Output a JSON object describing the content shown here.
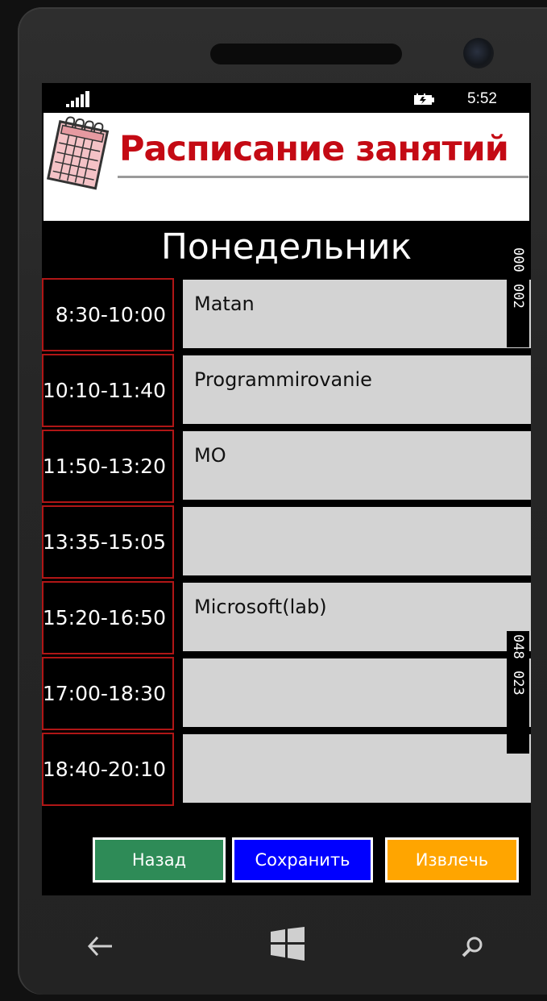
{
  "status_bar": {
    "time": "5:52",
    "signal_icon": "signal-strength-icon",
    "battery_icon": "battery-charging-icon"
  },
  "banner": {
    "title": "Расписание занятий",
    "icon": "calendar-icon"
  },
  "day_title": "Понедельник",
  "schedule": [
    {
      "time": "8:30-10:00",
      "subject": "Matan"
    },
    {
      "time": "10:10-11:40",
      "subject": "Programmirovanie"
    },
    {
      "time": "11:50-13:20",
      "subject": "MO"
    },
    {
      "time": "13:35-15:05",
      "subject": ""
    },
    {
      "time": "15:20-16:50",
      "subject": "Microsoft(lab)"
    },
    {
      "time": "17:00-18:30",
      "subject": ""
    },
    {
      "time": "18:40-20:10",
      "subject": ""
    }
  ],
  "debug_counters": {
    "top": [
      "000",
      "002"
    ],
    "bottom": [
      "048",
      "023"
    ]
  },
  "buttons": {
    "back": {
      "label": "Назад",
      "color": "#2e8b57"
    },
    "save": {
      "label": "Сохранить",
      "color": "#0000ff"
    },
    "extract": {
      "label": "Извлечь",
      "color": "#ffa500"
    }
  },
  "nav": {
    "back_icon": "back-arrow-icon",
    "start_icon": "windows-start-icon",
    "search_icon": "search-icon"
  }
}
